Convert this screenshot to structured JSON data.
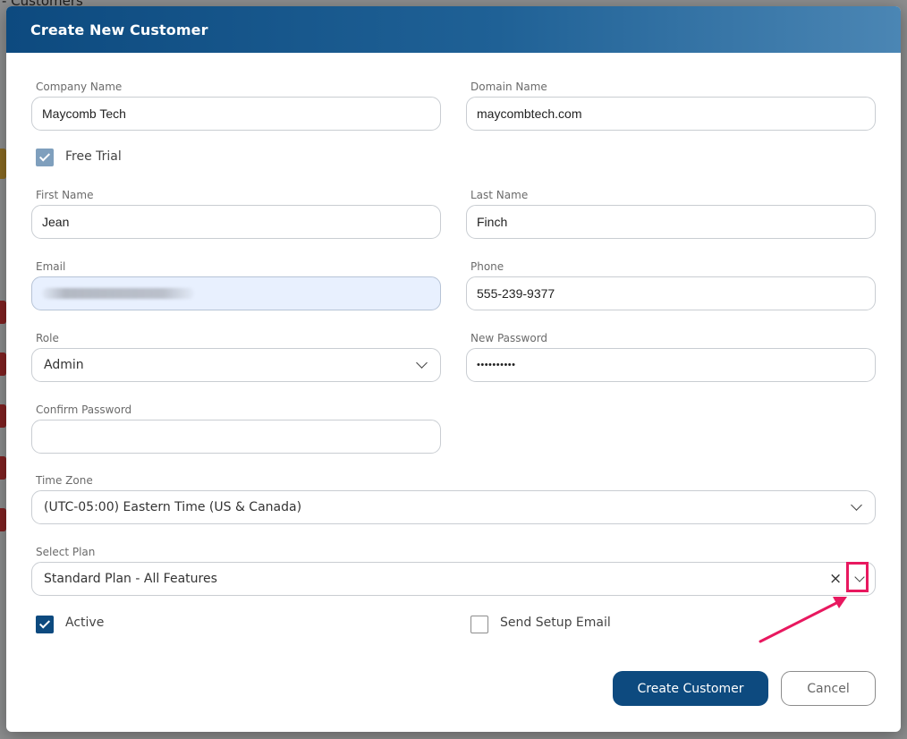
{
  "background": {
    "page_title": "- Customers"
  },
  "modal": {
    "title": "Create New Customer",
    "fields": {
      "company_name": {
        "label": "Company Name",
        "value": "Maycomb Tech"
      },
      "domain_name": {
        "label": "Domain Name",
        "value": "maycombtech.com"
      },
      "free_trial": {
        "label": "Free Trial",
        "checked": true
      },
      "first_name": {
        "label": "First Name",
        "value": "Jean"
      },
      "last_name": {
        "label": "Last Name",
        "value": "Finch"
      },
      "email": {
        "label": "Email",
        "value": ""
      },
      "phone": {
        "label": "Phone",
        "value": "555-239-9377"
      },
      "role": {
        "label": "Role",
        "value": "Admin"
      },
      "new_password": {
        "label": "New Password",
        "value": "••••••••••"
      },
      "confirm_password": {
        "label": "Confirm Password",
        "value": ""
      },
      "time_zone": {
        "label": "Time Zone",
        "value": "(UTC-05:00) Eastern Time (US & Canada)"
      },
      "select_plan": {
        "label": "Select Plan",
        "value": "Standard Plan - All Features",
        "clear_glyph": "×"
      },
      "active": {
        "label": "Active",
        "checked": true
      },
      "send_setup_email": {
        "label": "Send Setup Email",
        "checked": false
      }
    },
    "buttons": {
      "create": "Create Customer",
      "cancel": "Cancel"
    }
  },
  "colors": {
    "header_start": "#0d4a7f",
    "header_end": "#4b86b4",
    "primary": "#0d4a7f",
    "annotation": "#e8185f"
  },
  "icons": {
    "dropdown": "chevron-down-icon",
    "clear": "close-icon",
    "check": "checkmark-icon",
    "annotation_arrow": "arrow-icon"
  }
}
